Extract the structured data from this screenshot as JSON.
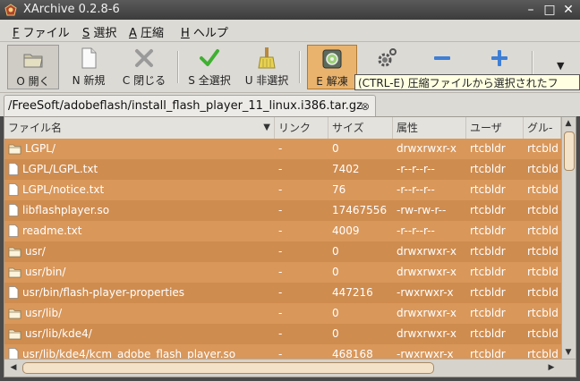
{
  "window": {
    "title": "XArchive 0.2.8-6"
  },
  "menubar": [
    {
      "key": "F",
      "label": "ファイル"
    },
    {
      "key": "S",
      "label": "選択"
    },
    {
      "key": "A",
      "label": "圧縮"
    },
    {
      "key": "H",
      "label": "ヘルプ"
    }
  ],
  "toolbar": {
    "open": "O 開く",
    "new": "N 新規",
    "close": "C 閉じる",
    "select_all": "S 全選択",
    "deselect": "U 非選択",
    "extract": "E 解凍"
  },
  "tooltip": "(CTRL-E) 圧縮ファイルから選択されたフ",
  "tab": {
    "path": "/FreeSoft/adobeflash/install_flash_player_11_linux.i386.tar.gz",
    "close": "⊗"
  },
  "columns": [
    "ファイル名",
    "リンク",
    "サイズ",
    "属性",
    "ユーザ",
    "グル-"
  ],
  "rows": [
    {
      "type": "folder",
      "name": "LGPL/",
      "link": "-",
      "size": "0",
      "attr": "drwxrwxr-x",
      "user": "rtcbldr",
      "group": "rtcbld"
    },
    {
      "type": "file",
      "name": "LGPL/LGPL.txt",
      "link": "-",
      "size": "7402",
      "attr": "-r--r--r--",
      "user": "rtcbldr",
      "group": "rtcbld"
    },
    {
      "type": "file",
      "name": "LGPL/notice.txt",
      "link": "-",
      "size": "76",
      "attr": "-r--r--r--",
      "user": "rtcbldr",
      "group": "rtcbld"
    },
    {
      "type": "file",
      "name": "libflashplayer.so",
      "link": "-",
      "size": "17467556",
      "attr": "-rw-rw-r--",
      "user": "rtcbldr",
      "group": "rtcbld"
    },
    {
      "type": "file",
      "name": "readme.txt",
      "link": "-",
      "size": "4009",
      "attr": "-r--r--r--",
      "user": "rtcbldr",
      "group": "rtcbld"
    },
    {
      "type": "folder",
      "name": "usr/",
      "link": "-",
      "size": "0",
      "attr": "drwxrwxr-x",
      "user": "rtcbldr",
      "group": "rtcbld"
    },
    {
      "type": "folder",
      "name": "usr/bin/",
      "link": "-",
      "size": "0",
      "attr": "drwxrwxr-x",
      "user": "rtcbldr",
      "group": "rtcbld"
    },
    {
      "type": "file",
      "name": "usr/bin/flash-player-properties",
      "link": "-",
      "size": "447216",
      "attr": "-rwxrwxr-x",
      "user": "rtcbldr",
      "group": "rtcbld"
    },
    {
      "type": "folder",
      "name": "usr/lib/",
      "link": "-",
      "size": "0",
      "attr": "drwxrwxr-x",
      "user": "rtcbldr",
      "group": "rtcbld"
    },
    {
      "type": "folder",
      "name": "usr/lib/kde4/",
      "link": "-",
      "size": "0",
      "attr": "drwxrwxr-x",
      "user": "rtcbldr",
      "group": "rtcbld"
    },
    {
      "type": "file",
      "name": "usr/lib/kde4/kcm_adobe_flash_player.so",
      "link": "-",
      "size": "468168",
      "attr": "-rwxrwxr-x",
      "user": "rtcbldr",
      "group": "rtcbld"
    }
  ]
}
